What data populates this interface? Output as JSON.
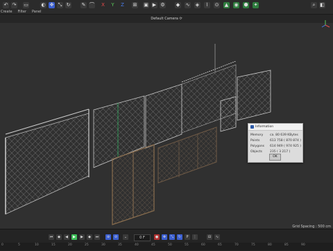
{
  "menu": [
    "Create",
    "Filter",
    "Panel"
  ],
  "toolbar": {
    "axis_x": "X",
    "axis_y": "Y",
    "axis_z": "Z"
  },
  "viewport": {
    "camera_label": "Default Camera",
    "camera_suffix": "⟳",
    "grid_spacing": "Grid Spacing : 500 cm"
  },
  "information_dialog": {
    "title": "Information",
    "rows": [
      {
        "key": "Memory",
        "value": "ca. 80 639 KBytes"
      },
      {
        "key": "Points",
        "value": "613 758 ( 870 874 )"
      },
      {
        "key": "Polygons",
        "value": "614 949 ( 974 925 )"
      },
      {
        "key": "Objects",
        "value": "235 ( 3 217 )"
      }
    ],
    "ok_label": "OK"
  },
  "timeline": {
    "current_frame": "0 F",
    "ruler_ticks": [
      "0",
      "5",
      "10",
      "15",
      "20",
      "25",
      "30",
      "35",
      "40",
      "45",
      "50",
      "55",
      "60",
      "65",
      "70",
      "75",
      "80",
      "85",
      "90"
    ]
  },
  "colors": {
    "accent_blue": "#3b5fd1",
    "axis_red": "#e84a4a",
    "axis_green": "#59c85a",
    "axis_blue": "#4a7be8",
    "play_green": "#3fbf5a"
  }
}
